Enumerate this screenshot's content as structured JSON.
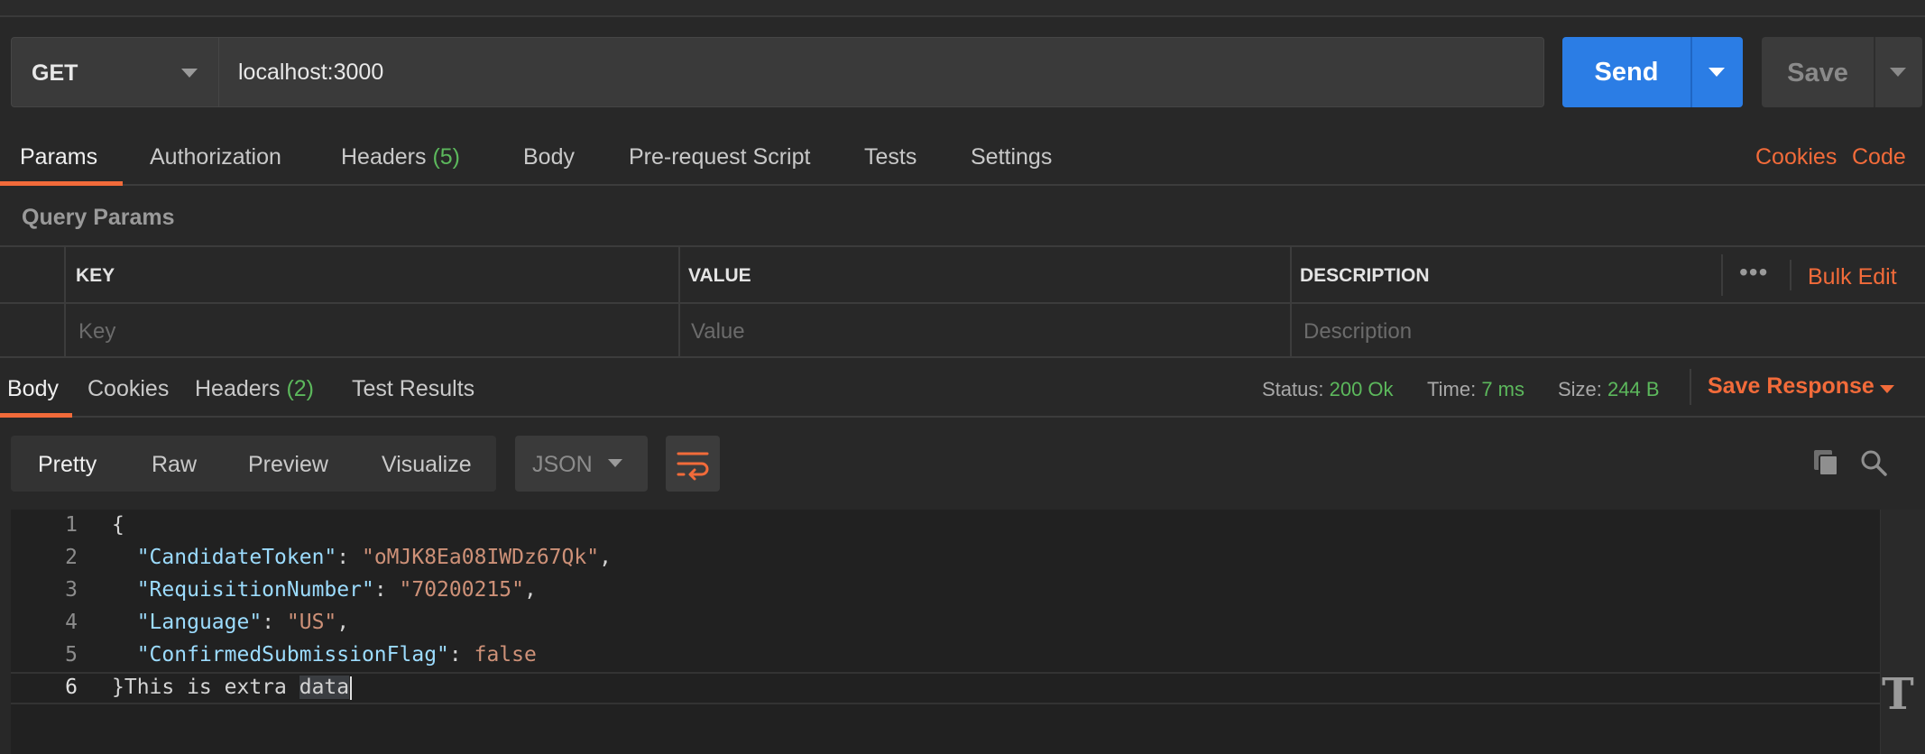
{
  "request": {
    "method": "GET",
    "url": "localhost:3000",
    "send_label": "Send",
    "save_label": "Save"
  },
  "request_tabs": {
    "params": "Params",
    "authorization": "Authorization",
    "headers": "Headers",
    "headers_count": "(5)",
    "body": "Body",
    "prerequest": "Pre-request Script",
    "tests": "Tests",
    "settings": "Settings",
    "cookies": "Cookies",
    "code": "Code"
  },
  "query_params": {
    "title": "Query Params",
    "col_key": "KEY",
    "col_value": "VALUE",
    "col_description": "DESCRIPTION",
    "bulk_edit": "Bulk Edit",
    "key_placeholder": "Key",
    "value_placeholder": "Value",
    "description_placeholder": "Description"
  },
  "response_tabs": {
    "body": "Body",
    "cookies": "Cookies",
    "headers": "Headers",
    "headers_count": "(2)",
    "test_results": "Test Results"
  },
  "status": {
    "status_label": "Status:",
    "status_value": "200 Ok",
    "time_label": "Time:",
    "time_value": "7 ms",
    "size_label": "Size:",
    "size_value": "244 B",
    "save_response": "Save Response"
  },
  "view": {
    "pretty": "Pretty",
    "raw": "Raw",
    "preview": "Preview",
    "visualize": "Visualize",
    "format": "JSON"
  },
  "code": {
    "line_numbers": [
      "1",
      "2",
      "3",
      "4",
      "5",
      "6"
    ],
    "open_brace": "{",
    "lines": [
      {
        "key": "\"CandidateToken\"",
        "value": "\"oMJK8Ea08IWDz67Qk\"",
        "trail": ","
      },
      {
        "key": "\"RequisitionNumber\"",
        "value": "\"70200215\"",
        "trail": ","
      },
      {
        "key": "\"Language\"",
        "value": "\"US\"",
        "trail": ","
      },
      {
        "key": "\"ConfirmedSubmissionFlag\"",
        "value": "false",
        "trail": ""
      }
    ],
    "last_line_prefix": "}This is extra ",
    "last_line_selected": "data"
  },
  "colors": {
    "accent": "#f26b3a",
    "send": "#2b7de5",
    "success": "#5cb85c"
  }
}
